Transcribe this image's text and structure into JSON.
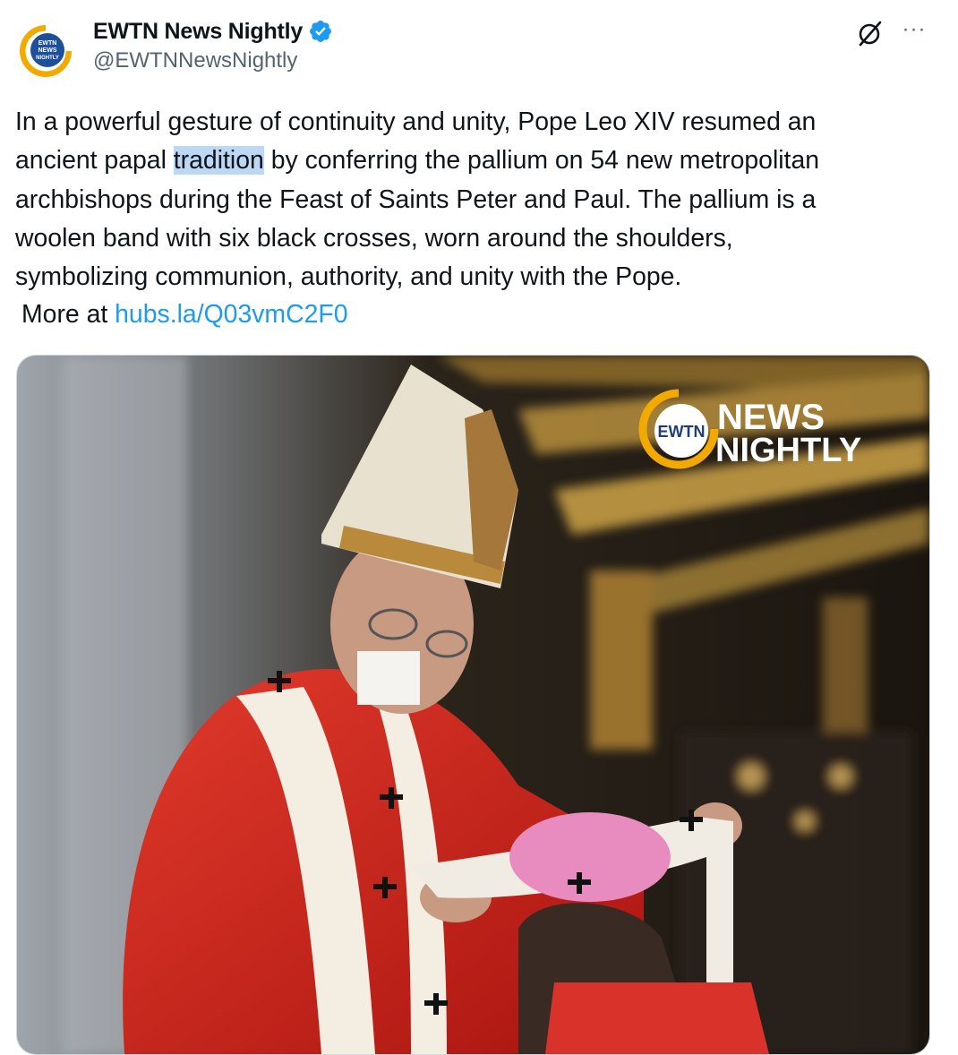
{
  "author": {
    "name": "EWTN News Nightly",
    "handle": "@EWTNNewsNightly",
    "avatar_text": [
      "EWTN",
      "NEWS",
      "NIGHTLY"
    ],
    "verified_icon": "verified-badge-icon"
  },
  "actions": {
    "grok_icon": "grok-icon",
    "more_label": "···"
  },
  "tweet": {
    "line1": "In a powerful gesture of continuity and unity, Pope Leo XIV resumed an",
    "line2_before": "ancient papal ",
    "line2_highlight": "tradition",
    "line2_after": " by conferring the pallium on 54 new metropolitan",
    "line3": "archbishops during the Feast of Saints Peter and Paul. The pallium is a",
    "line4": "woolen band with six black crosses, worn around the shoulders,",
    "line5": "symbolizing communion, authority, and unity with the Pope.",
    "more_prefix": "More at ",
    "link_text": "hubs.la/Q03vmC2F0"
  },
  "media": {
    "logo_badge": "EWTN",
    "logo_line1": "NEWS",
    "logo_line2": "NIGHTLY"
  },
  "colors": {
    "link": "#1d9bf0",
    "highlight": "#bcd8f5",
    "verified": "#1d9bf0",
    "logo_gold": "#f2a900",
    "vestment_red": "#c8221c"
  }
}
